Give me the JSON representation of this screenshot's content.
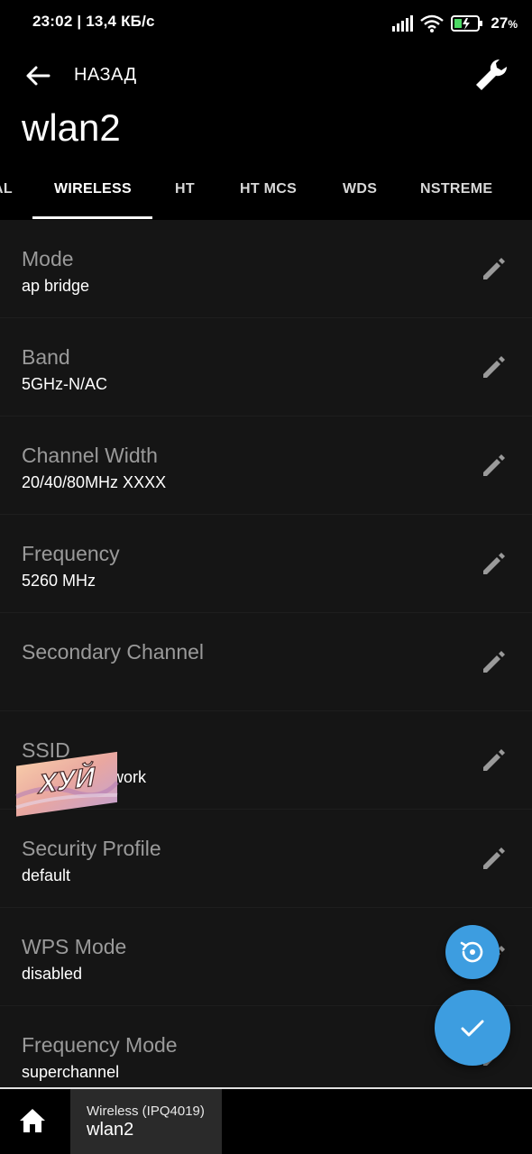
{
  "status_bar": {
    "time_speed": "23:02 | 13,4 КБ/с",
    "battery_percent": "27",
    "battery_suffix": "%"
  },
  "app_bar": {
    "back_label": "НАЗАД",
    "title": "wlan2"
  },
  "tabs": [
    {
      "label": "AL",
      "active": false
    },
    {
      "label": "WIRELESS",
      "active": true
    },
    {
      "label": "HT",
      "active": false
    },
    {
      "label": "HT MCS",
      "active": false
    },
    {
      "label": "WDS",
      "active": false
    },
    {
      "label": "NSTREME",
      "active": false
    }
  ],
  "settings": [
    {
      "title": "Mode",
      "value": "ap bridge"
    },
    {
      "title": "Band",
      "value": "5GHz-N/AC"
    },
    {
      "title": "Channel Width",
      "value": "20/40/80MHz XXXX"
    },
    {
      "title": "Frequency",
      "value": "5260 MHz"
    },
    {
      "title": "Secondary Channel",
      "value": ""
    },
    {
      "title": "SSID",
      "value": "work"
    },
    {
      "title": "Security Profile",
      "value": "default"
    },
    {
      "title": "WPS Mode",
      "value": "disabled"
    },
    {
      "title": "Frequency Mode",
      "value": "superchannel"
    }
  ],
  "sticker": {
    "text": "ХУЙ"
  },
  "bottom_bar": {
    "tab_subtitle": "Wireless (IPQ4019)",
    "tab_title": "wlan2"
  },
  "colors": {
    "accent": "#3d9de0",
    "background": "#151515",
    "header": "#000000"
  }
}
